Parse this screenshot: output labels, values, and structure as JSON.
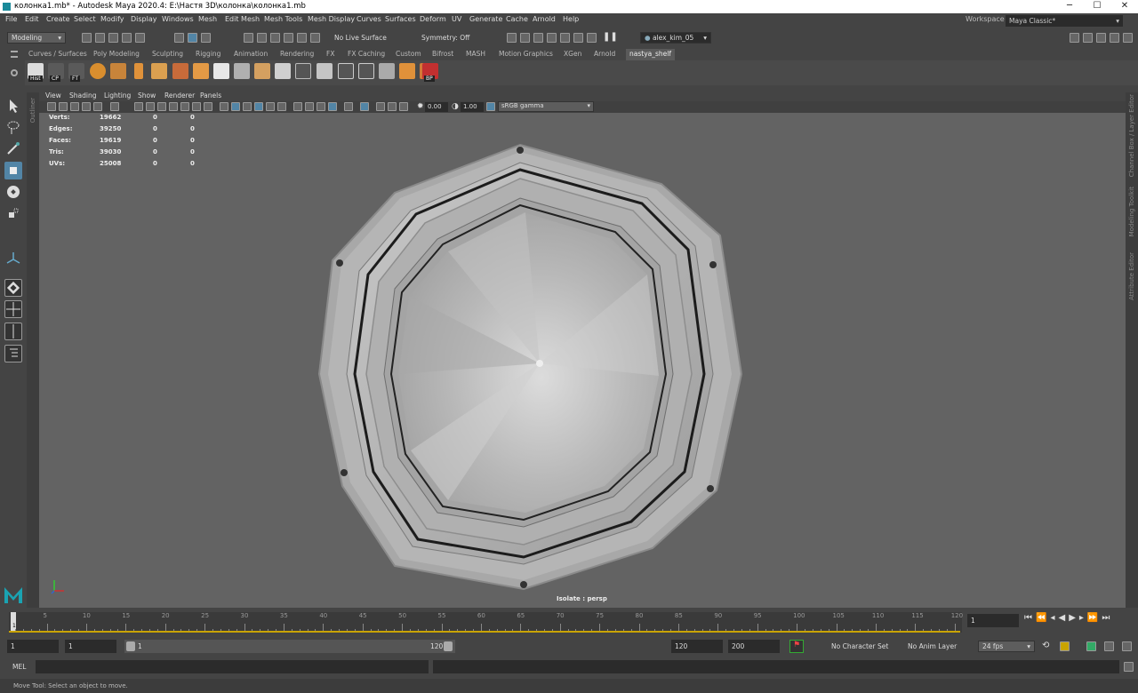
{
  "window": {
    "title": "колонка1.mb* - Autodesk Maya 2020.4: E:\\Настя 3D\\колонка\\колонка1.mb",
    "minimize": "─",
    "maximize": "☐",
    "close": "✕"
  },
  "menu": [
    "File",
    "Edit",
    "Create",
    "Select",
    "Modify",
    "Display",
    "Windows",
    "Mesh",
    "Edit Mesh",
    "Mesh Tools",
    "Mesh Display",
    "Curves",
    "Surfaces",
    "Deform",
    "UV",
    "Generate",
    "Cache",
    "Arnold",
    "Help"
  ],
  "workspace": {
    "label": "Workspace :",
    "value": "Maya Classic*"
  },
  "status": {
    "mode": "Modeling",
    "live_surface": "No Live Surface",
    "symmetry": "Symmetry: Off",
    "user": "alex_kim_05"
  },
  "shelf_tabs": [
    "Curves / Surfaces",
    "Poly Modeling",
    "Sculpting",
    "Rigging",
    "Animation",
    "Rendering",
    "FX",
    "FX Caching",
    "Custom",
    "Bifrost",
    "MASH",
    "Motion Graphics",
    "XGen",
    "Arnold",
    "nastya_shelf"
  ],
  "shelf_active": "nastya_shelf",
  "shelf_labels": {
    "hist": "Hist",
    "cp": "CP",
    "ft": "FT",
    "bp": "BP"
  },
  "panel_menu": [
    "View",
    "Shading",
    "Lighting",
    "Show",
    "Renderer",
    "Panels"
  ],
  "panel_toolbar": {
    "exposure": "0.00",
    "gamma": "1.00",
    "color_space": "sRGB gamma"
  },
  "side_labels": {
    "outliner": "Outliner",
    "channel_box": "Channel Box / Layer Editor",
    "modeling_toolkit": "Modeling Toolkit",
    "attribute_editor": "Attribute Editor"
  },
  "hud": [
    {
      "label": "Verts:",
      "a": "19662",
      "b": "0",
      "c": "0"
    },
    {
      "label": "Edges:",
      "a": "39250",
      "b": "0",
      "c": "0"
    },
    {
      "label": "Faces:",
      "a": "19619",
      "b": "0",
      "c": "0"
    },
    {
      "label": "Tris:",
      "a": "39030",
      "b": "0",
      "c": "0"
    },
    {
      "label": "UVs:",
      "a": "25008",
      "b": "0",
      "c": "0"
    }
  ],
  "viewport_label": "Isolate : persp",
  "timeline": {
    "ticks": [
      "5",
      "10",
      "15",
      "20",
      "25",
      "30",
      "35",
      "40",
      "45",
      "50",
      "55",
      "60",
      "65",
      "70",
      "75",
      "80",
      "85",
      "90",
      "95",
      "100",
      "105",
      "110",
      "115",
      "120"
    ],
    "start_marker": "1",
    "current_frame": "1"
  },
  "range": {
    "start": "1",
    "playback_start": "1",
    "slider_start": "1",
    "slider_end": "120",
    "playback_end": "120",
    "end": "200",
    "character_set": "No Character Set",
    "anim_layer": "No Anim Layer",
    "fps": "24 fps"
  },
  "command": {
    "lang": "MEL"
  },
  "help_text": "Move Tool: Select an object to move.",
  "colors": {
    "accent": "#5285a6",
    "viewport": "#636363",
    "panel": "#444444",
    "field": "#2b2b2b"
  }
}
